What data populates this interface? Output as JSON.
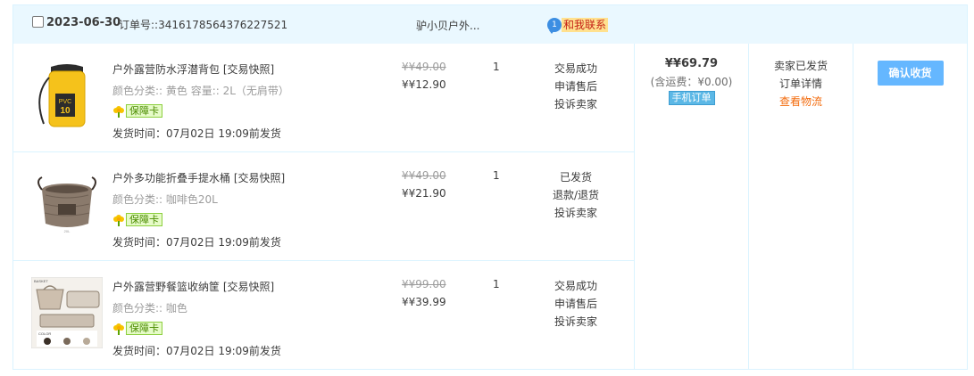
{
  "order": {
    "date": "2023-06-30",
    "order_no_label": "订单号::",
    "order_no": "3416178564376227521",
    "shop": "驴小贝户外...",
    "contact_label": "和我联系",
    "chat_badge": "1"
  },
  "items": [
    {
      "title": "户外露营防水浮潜背包",
      "snapshot": "[交易快照]",
      "spec": "颜色分类::  黄色   容量::  2L（无肩带）",
      "badge": "保障卡",
      "ship_time": "发货时间：07月02日 19:09前发货",
      "original_price": "¥¥49.00",
      "price": "¥¥12.90",
      "quantity": "1",
      "status": [
        "交易成功",
        "申请售后",
        "投诉卖家"
      ]
    },
    {
      "title": "户外多功能折叠手提水桶",
      "snapshot": "[交易快照]",
      "spec": "颜色分类::  咖啡色20L",
      "badge": "保障卡",
      "ship_time": "发货时间：07月02日 19:09前发货",
      "original_price": "¥¥49.00",
      "price": "¥¥21.90",
      "quantity": "1",
      "status": [
        "已发货",
        "退款/退货",
        "投诉卖家"
      ]
    },
    {
      "title": "户外露营野餐篮收纳筐",
      "snapshot": "[交易快照]",
      "spec": "颜色分类::  咖色",
      "badge": "保障卡",
      "ship_time": "发货时间：07月02日 19:09前发货",
      "original_price": "¥¥99.00",
      "price": "¥¥39.99",
      "quantity": "1",
      "status": [
        "交易成功",
        "申请售后",
        "投诉卖家"
      ]
    }
  ],
  "total": {
    "amount": "¥¥69.79",
    "shipping": "(含运费：¥0.00)",
    "mobile_tag": "手机订单"
  },
  "trade": {
    "status": "卖家已发货",
    "detail": "订单详情",
    "logistics": "查看物流"
  },
  "actions": {
    "confirm": "确认收货"
  },
  "colors": {
    "header_bg": "#eaf8ff",
    "border": "#daf3ff",
    "button": "#65b7ff",
    "logistics_link": "#f36b0d"
  },
  "icons": [
    "checkbox",
    "chat-bubble-icon",
    "guarantee-flower-icon"
  ]
}
